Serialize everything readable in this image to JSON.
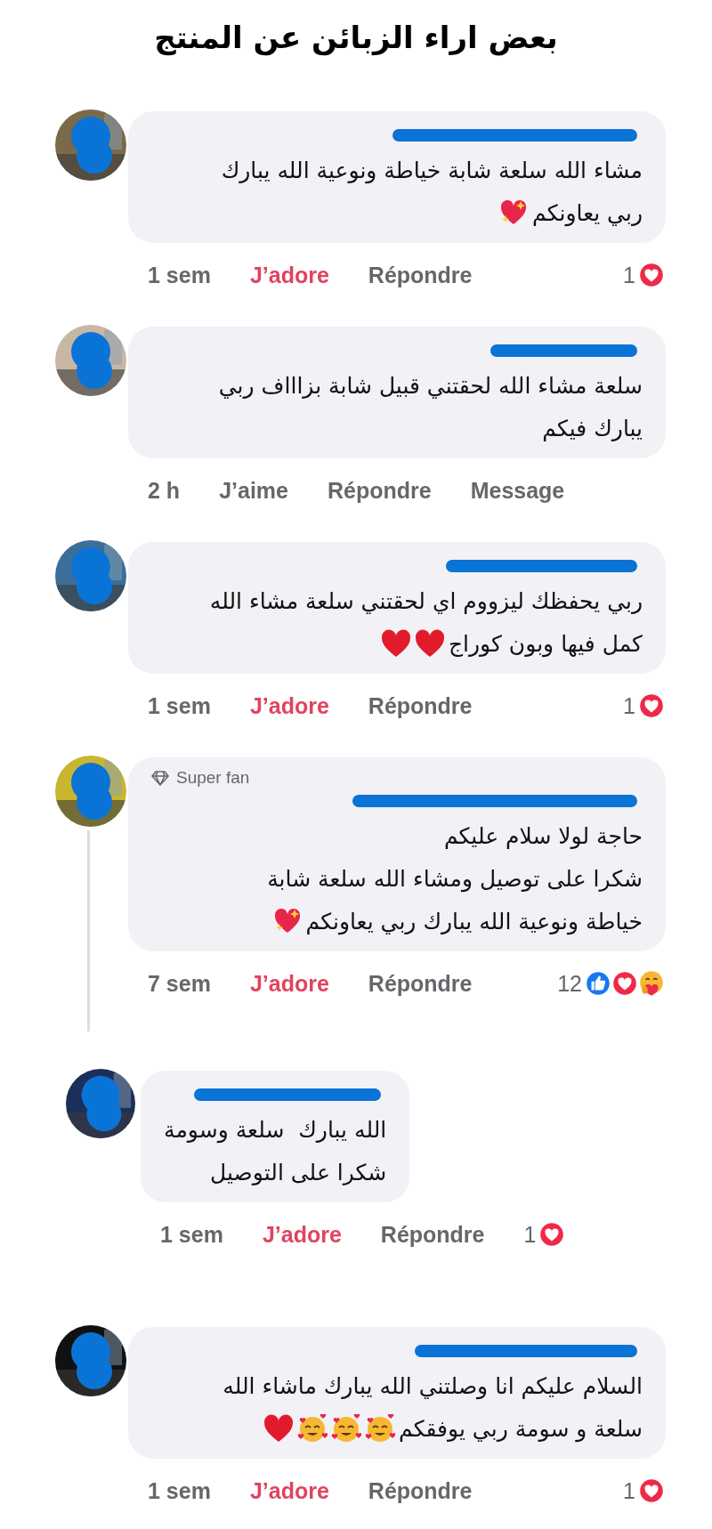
{
  "title": "بعض اراء الزبائن عن المنتج",
  "comments": [
    {
      "kind": "comment",
      "lines": [
        {
          "text": "مشاء الله سلعة شابة خياطة ونوعية الله يبارك"
        },
        {
          "text": "ربي يعاونكم",
          "emojis": [
            {
              "kind": "sparkle-heart"
            }
          ]
        }
      ],
      "time": "1 sem",
      "reaction_button": {
        "label": "J’adore",
        "selected": true
      },
      "reply_button": {
        "label": "Répondre"
      },
      "reactions": {
        "count": "1",
        "icons": [
          {
            "kind": "love"
          }
        ]
      },
      "has_replies": false
    },
    {
      "kind": "comment",
      "lines": [
        {
          "text": "سلعة مشاء الله لحقتني قبيل شابة بزاااف ربي"
        },
        {
          "text": "يبارك فيكم"
        }
      ],
      "time": "2 h",
      "reaction_button": {
        "label": "J’aime",
        "selected": false
      },
      "reply_button": {
        "label": "Répondre"
      },
      "message_button": {
        "label": "Message"
      },
      "has_replies": false
    },
    {
      "kind": "comment",
      "lines": [
        {
          "text": "ربي يحفظك ليزووم اي لحقتني سلعة مشاء الله"
        },
        {
          "text": "كمل فيها وبون كوراج",
          "emojis": [
            {
              "kind": "red-heart"
            },
            {
              "kind": "red-heart"
            }
          ]
        }
      ],
      "time": "1 sem",
      "reaction_button": {
        "label": "J’adore",
        "selected": true
      },
      "reply_button": {
        "label": "Répondre"
      },
      "reactions": {
        "count": "1",
        "icons": [
          {
            "kind": "love"
          }
        ]
      },
      "has_replies": false
    },
    {
      "kind": "comment",
      "badge": "Super fan",
      "lines": [
        {
          "text": "حاجة لولا سلام عليكم"
        },
        {
          "text": "شكرا على توصيل ومشاء الله سلعة شابة"
        },
        {
          "text": "خياطة ونوعية الله يبارك ربي يعاونكم",
          "emojis": [
            {
              "kind": "sparkle-heart"
            }
          ]
        }
      ],
      "time": "7 sem",
      "reaction_button": {
        "label": "J’adore",
        "selected": true
      },
      "reply_button": {
        "label": "Répondre"
      },
      "reactions": {
        "count": "12",
        "icons": [
          {
            "kind": "like"
          },
          {
            "kind": "love"
          },
          {
            "kind": "care"
          }
        ]
      },
      "has_replies": true
    },
    {
      "kind": "reply",
      "lines": [
        {
          "text": "الله يبارك  سلعة وسومة"
        },
        {
          "text": "شكرا على التوصيل"
        }
      ],
      "time": "1 sem",
      "reaction_button": {
        "label": "J’adore",
        "selected": true
      },
      "reply_button": {
        "label": "Répondre"
      },
      "reactions": {
        "count": "1",
        "icons": [
          {
            "kind": "love"
          }
        ]
      },
      "has_replies": false
    },
    {
      "kind": "comment",
      "lines": [
        {
          "text": "السلام عليكم انا وصلتني الله يبارك ماشاء الله"
        },
        {
          "text": "سلعة و سومة ربي يوفقكم",
          "emojis": [
            {
              "kind": "smiling-hearts"
            },
            {
              "kind": "smiling-hearts"
            },
            {
              "kind": "smiling-hearts"
            },
            {
              "kind": "red-heart"
            }
          ]
        }
      ],
      "time": "1 sem",
      "reaction_button": {
        "label": "J’adore",
        "selected": true
      },
      "reply_button": {
        "label": "Répondre"
      },
      "reactions": {
        "count": "1",
        "icons": [
          {
            "kind": "love"
          }
        ]
      },
      "has_replies": false
    },
    {
      "kind": "cut"
    }
  ]
}
